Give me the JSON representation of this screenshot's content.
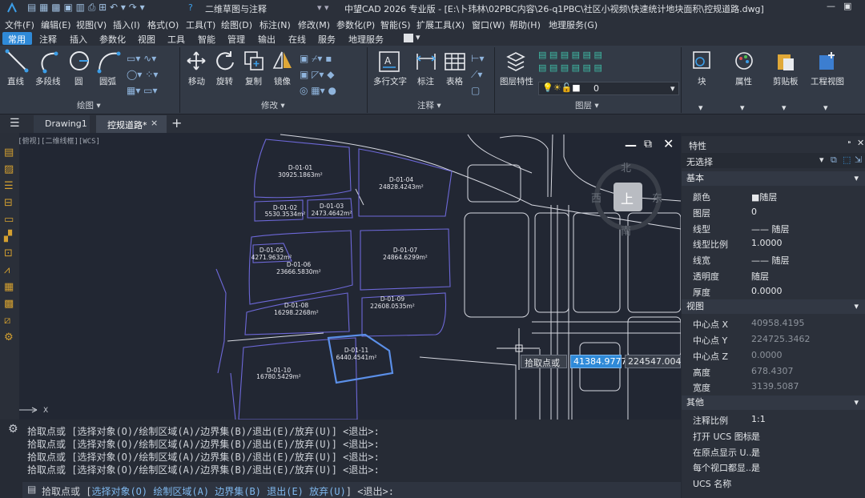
{
  "app": {
    "title": "中望CAD 2026 专业版 - [E:\\卜玮林\\02PBC内容\\26-q1PBC\\社区小视频\\快速统计地块面积\\控规道路.dwg]",
    "workspace": "二维草图与注释"
  },
  "menu": [
    "文件(F)",
    "编辑(E)",
    "视图(V)",
    "插入(I)",
    "格式(O)",
    "工具(T)",
    "绘图(D)",
    "标注(N)",
    "修改(M)",
    "参数化(P)",
    "智能(S)",
    "扩展工具(X)",
    "窗口(W)",
    "帮助(H)",
    "地理服务(G)"
  ],
  "ribbon_tabs": [
    "常用",
    "注释",
    "插入",
    "参数化",
    "视图",
    "工具",
    "智能",
    "管理",
    "输出",
    "在线",
    "服务",
    "地理服务"
  ],
  "ribbon": {
    "draw": {
      "line": "直线",
      "pline": "多段线",
      "circle": "圆",
      "arc": "圆弧",
      "group": "绘图 ▾"
    },
    "modify": {
      "move": "移动",
      "rotate": "旋转",
      "copy": "复制",
      "mirror": "镜像",
      "group": "修改 ▾"
    },
    "annot": {
      "mtext": "多行文字",
      "dim": "标注",
      "table": "表格",
      "group": "注释 ▾"
    },
    "layer": {
      "props": "图层特性",
      "current": "0",
      "group": "图层 ▾"
    },
    "block": "块",
    "attr": "属性",
    "clip": "剪贴板",
    "projview": "工程视图"
  },
  "doctabs": [
    "Drawing1",
    "控规道路*"
  ],
  "viewport_label": "[-][俯视][二维线框][WCS]",
  "compass": {
    "n": "北",
    "s": "南",
    "e": "东",
    "w": "西",
    "top": "上"
  },
  "parcels": [
    {
      "id": "D-01-01",
      "area": "30925.1863m²"
    },
    {
      "id": "D-01-02",
      "area": "5530.3534m²"
    },
    {
      "id": "D-01-03",
      "area": "2473.4642m²"
    },
    {
      "id": "D-01-04",
      "area": "24828.4243m²"
    },
    {
      "id": "D-01-05",
      "area": "4271.9632m²"
    },
    {
      "id": "D-01-06",
      "area": "23666.5830m²"
    },
    {
      "id": "D-01-07",
      "area": "24864.6299m²"
    },
    {
      "id": "D-01-08",
      "area": "16298.2268m²"
    },
    {
      "id": "D-01-09",
      "area": "22608.0535m²"
    },
    {
      "id": "D-01-10",
      "area": "16780.5429m²"
    },
    {
      "id": "D-01-11",
      "area": "6440.4541m²"
    }
  ],
  "dyn_input": {
    "prompt": "拾取点或",
    "x": "41384.9777",
    "y": "224547.0042"
  },
  "properties": {
    "title": "特性",
    "selection": "无选择",
    "basic": {
      "head": "基本",
      "rows": [
        [
          "颜色",
          "■随层"
        ],
        [
          "图层",
          "0"
        ],
        [
          "线型",
          "—— 随层"
        ],
        [
          "线型比例",
          "1.0000"
        ],
        [
          "线宽",
          "—— 随层"
        ],
        [
          "透明度",
          "随层"
        ],
        [
          "厚度",
          "0.0000"
        ]
      ]
    },
    "view": {
      "head": "视图",
      "rows": [
        [
          "中心点 X",
          "40958.4195"
        ],
        [
          "中心点 Y",
          "224725.3462"
        ],
        [
          "中心点 Z",
          "0.0000"
        ],
        [
          "高度",
          "678.4307"
        ],
        [
          "宽度",
          "3139.5087"
        ]
      ]
    },
    "other": {
      "head": "其他",
      "rows": [
        [
          "注释比例",
          "1:1"
        ],
        [
          "打开 UCS 图标",
          "是"
        ],
        [
          "在原点显示 U...",
          "是"
        ],
        [
          "每个视口都显...",
          "是"
        ],
        [
          "UCS 名称",
          ""
        ]
      ]
    }
  },
  "command": {
    "history": [
      "拾取点或 [选择对象(O)/绘制区域(A)/边界集(B)/退出(E)/放弃(U)] <退出>:",
      "拾取点或 [选择对象(O)/绘制区域(A)/边界集(B)/退出(E)/放弃(U)] <退出>:",
      "拾取点或 [选择对象(O)/绘制区域(A)/边界集(B)/退出(E)/放弃(U)] <退出>:",
      "拾取点或 [选择对象(O)/绘制区域(A)/边界集(B)/退出(E)/放弃(U)] <退出>:"
    ],
    "current": {
      "prompt": "拾取点或 [",
      "o": "选择对象(O)",
      "a": "绘制区域(A)",
      "b": "边界集(B)",
      "e": "退出(E)",
      "u": "放弃(U)",
      "tail": "] <退出>:"
    }
  },
  "colors": {
    "accent": "#2f8ad8",
    "boundary": "#6d68d8",
    "road": "#d8d8e0",
    "selected": "#5b8fe8"
  }
}
